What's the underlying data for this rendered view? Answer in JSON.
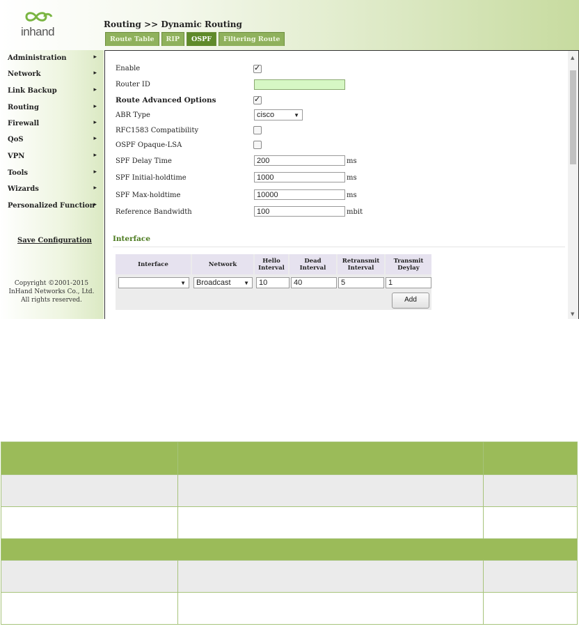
{
  "header": {
    "logo_text": "inhand",
    "breadcrumb": "Routing >> Dynamic Routing",
    "tabs": [
      "Route Table",
      "RIP",
      "OSPF",
      "Filtering Route"
    ],
    "active_tab": "OSPF"
  },
  "sidebar": {
    "items": [
      {
        "label": "Administration"
      },
      {
        "label": "Network"
      },
      {
        "label": "Link Backup"
      },
      {
        "label": "Routing"
      },
      {
        "label": "Firewall"
      },
      {
        "label": "QoS"
      },
      {
        "label": "VPN"
      },
      {
        "label": "Tools"
      },
      {
        "label": "Wizards"
      },
      {
        "label": "Personalized Function"
      }
    ],
    "arrow": "▸",
    "save_label": "Save Configuration",
    "copyright": [
      "Copyright ©2001-2015",
      "InHand Networks Co., Ltd.",
      "All rights reserved."
    ]
  },
  "form": {
    "enable_label": "Enable",
    "enable_checked": true,
    "router_id_label": "Router ID",
    "router_id_value": "",
    "advanced_label": "Route Advanced Options",
    "advanced_checked": true,
    "abr_label": "ABR Type",
    "abr_value": "cisco",
    "rfc_label": "RFC1583 Compatibility",
    "rfc_checked": false,
    "opaque_label": "OSPF Opaque-LSA",
    "opaque_checked": false,
    "spf_delay_label": "SPF Delay Time",
    "spf_delay_value": "200",
    "spf_delay_unit": "ms",
    "spf_initial_label": "SPF Initial-holdtime",
    "spf_initial_value": "1000",
    "spf_initial_unit": "ms",
    "spf_max_label": "SPF Max-holdtime",
    "spf_max_value": "10000",
    "spf_max_unit": "ms",
    "ref_bw_label": "Reference Bandwidth",
    "ref_bw_value": "100",
    "ref_bw_unit": "mbit"
  },
  "interface": {
    "title": "Interface",
    "headers": {
      "interface": "Interface",
      "network": "Network",
      "hello": [
        "Hello",
        "Interval"
      ],
      "dead": [
        "Dead",
        "Interval"
      ],
      "retransmit": [
        "Retransmit",
        "Interval"
      ],
      "transmit": [
        "Transmit",
        "Deylay"
      ]
    },
    "row": {
      "interface": "",
      "network": "Broadcast",
      "hello": "10",
      "dead": "40",
      "retransmit": "5",
      "transmit": "1"
    },
    "add_label": "Add"
  },
  "colors": {
    "accent_green": "#9bbb59",
    "tab_green": "#8fb15c",
    "router_id_bg": "#d6f7c4"
  }
}
